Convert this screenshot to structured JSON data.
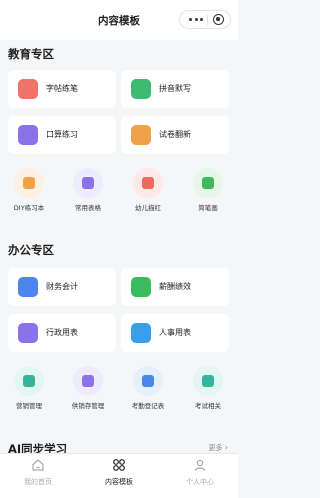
{
  "header": {
    "title": "内容模板"
  },
  "sections": {
    "education": {
      "title": "教育专区",
      "cards": [
        {
          "label": "字帖练笔",
          "icon": "pencil-note-icon",
          "color": "#f0736a"
        },
        {
          "label": "拼音默写",
          "icon": "pinyin-icon",
          "color": "#3dbb73"
        },
        {
          "label": "口算练习",
          "icon": "calculator-icon",
          "color": "#8a72e8"
        },
        {
          "label": "试卷翻新",
          "icon": "exam-paper-icon",
          "color": "#f0a14a"
        }
      ],
      "items": [
        {
          "label": "DIY练习本",
          "icon": "notebook-icon",
          "color": "#f0a14a",
          "bg": "#fdf0e2"
        },
        {
          "label": "常用表格",
          "icon": "list-table-icon",
          "color": "#8a72e8",
          "bg": "#efeafd"
        },
        {
          "label": "幼儿描红",
          "icon": "tracing-icon",
          "color": "#ee6a5e",
          "bg": "#fde9e7"
        },
        {
          "label": "简笔画",
          "icon": "drawing-icon",
          "color": "#3dbb5f",
          "bg": "#e6f7ea"
        }
      ]
    },
    "office": {
      "title": "办公专区",
      "cards": [
        {
          "label": "财务会计",
          "icon": "finance-icon",
          "color": "#4a86ee"
        },
        {
          "label": "薪酬绩效",
          "icon": "salary-chart-icon",
          "color": "#3dbb5f"
        },
        {
          "label": "行政用表",
          "icon": "admin-table-icon",
          "color": "#8a72e8"
        },
        {
          "label": "人事用表",
          "icon": "personnel-icon",
          "color": "#3a9fe6"
        }
      ],
      "items": [
        {
          "label": "营销管理",
          "icon": "marketing-icon",
          "color": "#36b59a",
          "bg": "#e4f6f1"
        },
        {
          "label": "供销存管理",
          "icon": "inventory-icon",
          "color": "#8a72e8",
          "bg": "#efeafd"
        },
        {
          "label": "考勤登记表",
          "icon": "attendance-icon",
          "color": "#4a86ee",
          "bg": "#e6effd"
        },
        {
          "label": "考试相关",
          "icon": "exam-icon",
          "color": "#36b59a",
          "bg": "#e4f6f1"
        }
      ]
    },
    "ai": {
      "title": "AI同步学习",
      "more": "更多"
    }
  },
  "tabbar": [
    {
      "label": "我的首页",
      "icon": "home-icon",
      "active": false
    },
    {
      "label": "内容模板",
      "icon": "template-grid-icon",
      "active": true
    },
    {
      "label": "个人中心",
      "icon": "user-icon",
      "active": false
    }
  ]
}
